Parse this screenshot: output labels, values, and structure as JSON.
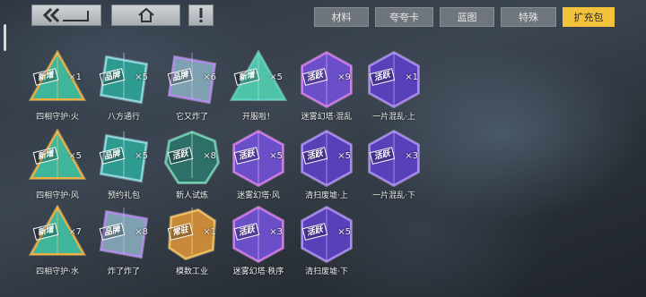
{
  "tabs": [
    "材料",
    "夸夸卡",
    "蓝图",
    "特殊",
    "扩充包"
  ],
  "active_tab": "扩充包",
  "items": [
    {
      "name": "四相守护·火",
      "count": "×1",
      "badge": "新增",
      "kind": "tri-orange"
    },
    {
      "name": "八方通行",
      "count": "×5",
      "badge": "品牌",
      "kind": "card-teal"
    },
    {
      "name": "它又炸了",
      "count": "×6",
      "badge": "品牌",
      "kind": "card-purple"
    },
    {
      "name": "开服啦！",
      "count": "×5",
      "badge": "新增",
      "kind": "tri-teal"
    },
    {
      "name": "迷雾幻塔·混乱",
      "count": "×9",
      "badge": "活跃",
      "kind": "d20-purple"
    },
    {
      "name": "一片混乱·上",
      "count": "×1",
      "badge": "活跃",
      "kind": "d20-violet"
    },
    {
      "name": "四相守护·风",
      "count": "×5",
      "badge": "新增",
      "kind": "tri-orange"
    },
    {
      "name": "预约礼包",
      "count": "×5",
      "badge": "品牌",
      "kind": "card-teal"
    },
    {
      "name": "新人试炼",
      "count": "×8",
      "badge": "活跃",
      "kind": "round-teal"
    },
    {
      "name": "迷雾幻塔·风",
      "count": "×5",
      "badge": "活跃",
      "kind": "d20-purple"
    },
    {
      "name": "清扫废墟·上",
      "count": "×5",
      "badge": "活跃",
      "kind": "d20-violet"
    },
    {
      "name": "一片混乱·下",
      "count": "×3",
      "badge": "活跃",
      "kind": "d20-violet"
    },
    {
      "name": "四相守护·水",
      "count": "×7",
      "badge": "新增",
      "kind": "tri-orange"
    },
    {
      "name": "炸了炸了",
      "count": "×8",
      "badge": "品牌",
      "kind": "card-purple"
    },
    {
      "name": "模数工业",
      "count": "×1",
      "badge": "常驻",
      "kind": "box-gold"
    },
    {
      "name": "迷雾幻塔·秩序",
      "count": "×3",
      "badge": "活跃",
      "kind": "d20-purple"
    },
    {
      "name": "清扫废墟·下",
      "count": "×5",
      "badge": "活跃",
      "kind": "d20-violet"
    }
  ]
}
